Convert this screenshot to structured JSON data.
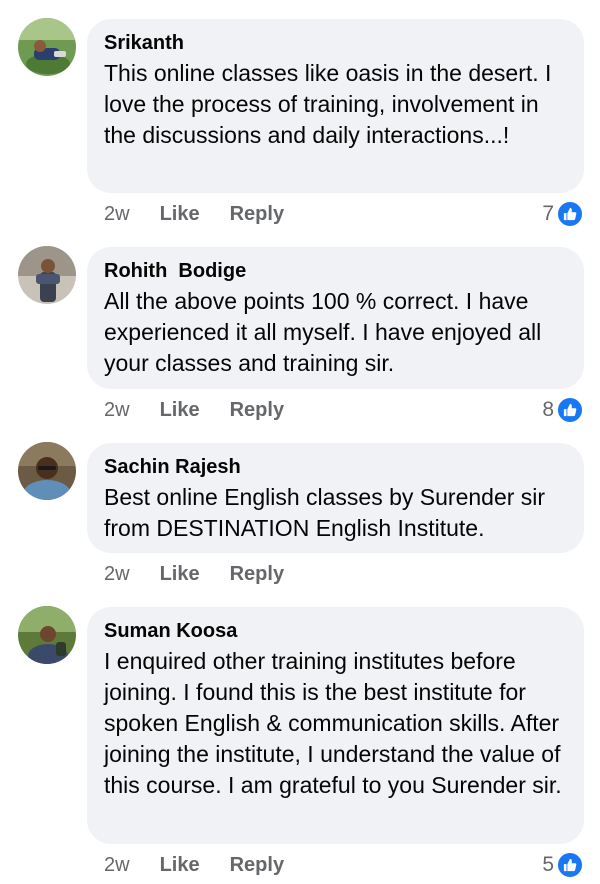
{
  "comments": [
    {
      "author": "Srikanth",
      "text": "This online classes like oasis in the desert. I love the process of training, involvement in the discussions and daily interactions...!",
      "time": "2w",
      "like_label": "Like",
      "reply_label": "Reply",
      "reaction_count": "7"
    },
    {
      "author": "Rohith  Bodige",
      "text": "All the above points 100 % correct. I have experienced it all myself. I have enjoyed all your classes and training sir.",
      "time": "2w",
      "like_label": "Like",
      "reply_label": "Reply",
      "reaction_count": "8"
    },
    {
      "author": "Sachin Rajesh",
      "text": "Best online English classes by Surender sir from DESTINATION English Institute.",
      "time": "2w",
      "like_label": "Like",
      "reply_label": "Reply"
    },
    {
      "author": "Suman Koosa",
      "text": "I enquired other training institutes before joining. I found this is the best institute for spoken English & communication skills. After joining the institute, I understand the value of this course. I am grateful to you Surender sir.",
      "time": "2w",
      "like_label": "Like",
      "reply_label": "Reply",
      "reaction_count": "5"
    }
  ],
  "colors": {
    "bubble": "#f0f2f5",
    "text": "#050505",
    "meta": "#65676b",
    "like_badge": "#1877f2"
  },
  "icons": {
    "reaction": "thumbs-up-icon"
  }
}
